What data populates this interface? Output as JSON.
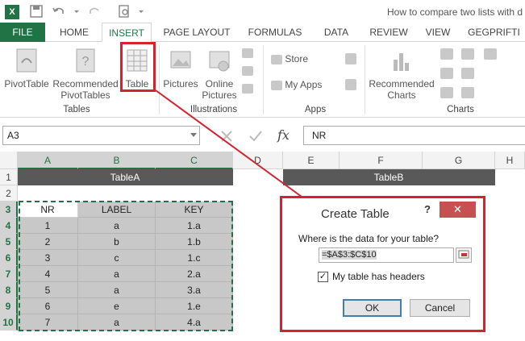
{
  "window": {
    "title": "How to compare two lists with d"
  },
  "tabs": [
    "FILE",
    "HOME",
    "INSERT",
    "PAGE LAYOUT",
    "FORMULAS",
    "DATA",
    "REVIEW",
    "VIEW",
    "GEGPRIFTI"
  ],
  "ribbon": {
    "pivottable": "PivotTable",
    "recommended_pivot": "Recommended PivotTables",
    "table": "Table",
    "pictures": "Pictures",
    "online_pictures": "Online Pictures",
    "store": "Store",
    "my_apps": "My Apps",
    "recommended_charts": "Recommended Charts",
    "groups": {
      "tables": "Tables",
      "illustrations": "Illustrations",
      "apps": "Apps",
      "charts": "Charts"
    }
  },
  "formula_bar": {
    "name_box": "A3",
    "fx": "fx",
    "content": "NR"
  },
  "columns": [
    "A",
    "B",
    "C",
    "D",
    "E",
    "F",
    "G",
    "H"
  ],
  "rows": [
    "1",
    "2",
    "3",
    "4",
    "5",
    "6",
    "7",
    "8",
    "9",
    "10"
  ],
  "sheet": {
    "table_a_title": "TableA",
    "table_b_title": "TableB",
    "headers": [
      "NR",
      "LABEL",
      "KEY"
    ],
    "data": [
      [
        "1",
        "a",
        "1.a"
      ],
      [
        "2",
        "b",
        "1.b"
      ],
      [
        "3",
        "c",
        "1.c"
      ],
      [
        "4",
        "a",
        "2.a"
      ],
      [
        "5",
        "a",
        "3.a"
      ],
      [
        "6",
        "e",
        "1.e"
      ],
      [
        "7",
        "a",
        "4.a"
      ]
    ]
  },
  "dialog": {
    "title": "Create Table",
    "help": "?",
    "close": "✕",
    "question": "Where is the data for your table?",
    "range": "=$A$3:$C$10",
    "checkbox_label": "My table has headers",
    "checkbox_mark": "✓",
    "ok": "OK",
    "cancel": "Cancel"
  },
  "colors": {
    "excel_green": "#217346",
    "highlight_red": "#d6212f",
    "table_header_dark": "#595959"
  }
}
